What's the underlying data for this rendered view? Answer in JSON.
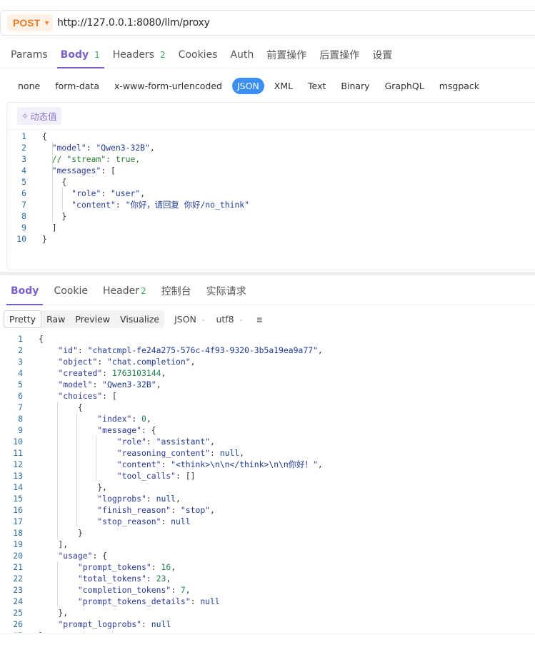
{
  "request": {
    "method": "POST",
    "url": "http://127.0.0.1:8080/llm/proxy"
  },
  "request_tabs": [
    {
      "label": "Params",
      "count": ""
    },
    {
      "label": "Body",
      "count": "1"
    },
    {
      "label": "Headers",
      "count": "2"
    },
    {
      "label": "Cookies",
      "count": ""
    },
    {
      "label": "Auth",
      "count": ""
    },
    {
      "label": "前置操作",
      "count": ""
    },
    {
      "label": "后置操作",
      "count": ""
    },
    {
      "label": "设置",
      "count": ""
    }
  ],
  "body_types": [
    "none",
    "form-data",
    "x-www-form-urlencoded",
    "JSON",
    "XML",
    "Text",
    "Binary",
    "GraphQL",
    "msgpack"
  ],
  "body_type_selected": "JSON",
  "dynamic_value_label": "动态值",
  "request_code": [
    "{",
    "  \"model\": \"Qwen3-32B\",",
    "  // \"stream\": true,",
    "  \"messages\": [",
    "    {",
    "      \"role\": \"user\",",
    "      \"content\": \"你好，请回复 你好/no_think\"",
    "    }",
    "  ]",
    "}"
  ],
  "response_tabs": [
    {
      "label": "Body",
      "count": ""
    },
    {
      "label": "Cookie",
      "count": ""
    },
    {
      "label": "Header",
      "count": "2"
    },
    {
      "label": "控制台",
      "count": ""
    },
    {
      "label": "实际请求",
      "count": ""
    }
  ],
  "view_modes": [
    "Pretty",
    "Raw",
    "Preview",
    "Visualize"
  ],
  "view_mode_selected": "Pretty",
  "format_select": "JSON",
  "encoding_select": "utf8",
  "response_code": [
    "{",
    "    \"id\": \"chatcmpl-fe24a275-576c-4f93-9320-3b5a19ea9a77\",",
    "    \"object\": \"chat.completion\",",
    "    \"created\": 1763103144,",
    "    \"model\": \"Qwen3-32B\",",
    "    \"choices\": [",
    "        {",
    "            \"index\": 0,",
    "            \"message\": {",
    "                \"role\": \"assistant\",",
    "                \"reasoning_content\": null,",
    "                \"content\": \"<think>\\n\\n</think>\\n\\n你好！\",",
    "                \"tool_calls\": []",
    "            },",
    "            \"logprobs\": null,",
    "            \"finish_reason\": \"stop\",",
    "            \"stop_reason\": null",
    "        }",
    "    ],",
    "    \"usage\": {",
    "        \"prompt_tokens\": 16,",
    "        \"total_tokens\": 23,",
    "        \"completion_tokens\": 7,",
    "        \"prompt_tokens_details\": null",
    "    },",
    "    \"prompt_logprobs\": null",
    "}"
  ],
  "colors": {
    "accent": "#7a5fc7",
    "method": "#f07b25",
    "selected_body_type": "#3a8ef4",
    "count": "#3cab5d"
  }
}
